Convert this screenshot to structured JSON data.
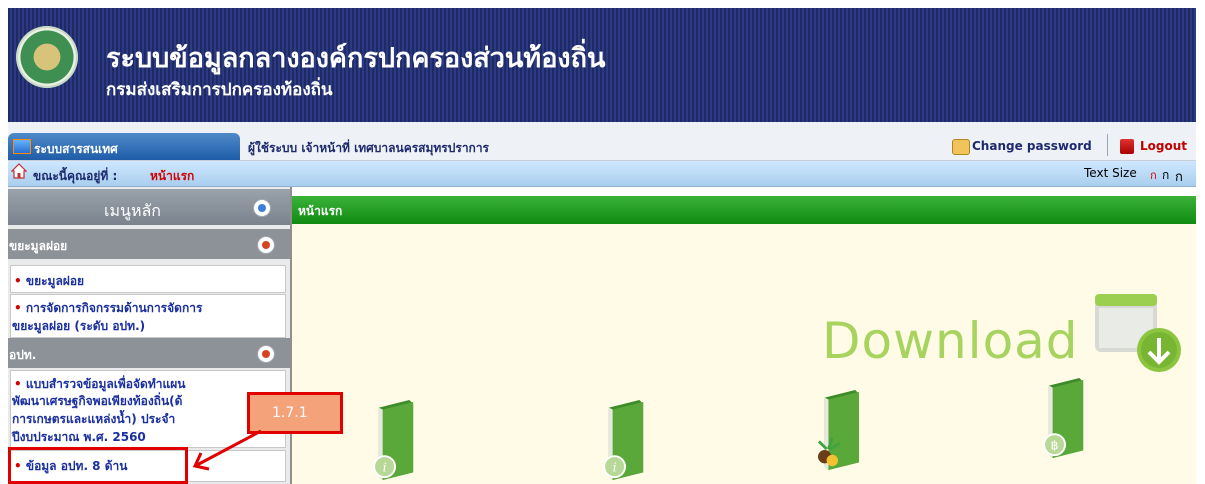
{
  "header": {
    "title": "ระบบข้อมูลกลางองค์กรปกครองส่วนท้องถิ่น",
    "subtitle": "กรมส่งเสริมการปกครองท้องถิ่น"
  },
  "topbar": {
    "system_tab": "ระบบสารสนเทศ",
    "user_info": "ผู้ใช้ระบบ เจ้าหน้าที่ เทศบาลนครสมุทรปราการ",
    "change_password": "Change password",
    "logout": "Logout"
  },
  "location": {
    "label": "ขณะนี้คุณอยู่ที่ :",
    "value": "หน้าแรก",
    "text_size_label": "Text Size",
    "text_size_options": [
      "ก",
      "ก",
      "ก"
    ]
  },
  "sidebar": {
    "title": "เมนูหลัก",
    "sections": [
      {
        "title": "ขยะมูลฝอย",
        "items": [
          {
            "lines": [
              "ขยะมูลฝอย"
            ]
          },
          {
            "lines": [
              "การจัดการกิจกรรมด้านการจัดการ",
              "ขยะมูลฝอย (ระดับ อปท.)"
            ]
          }
        ]
      },
      {
        "title": "อปท.",
        "items": [
          {
            "lines": [
              "แบบสำรวจข้อมูลเพื่อจัดทำแผน",
              "พัฒนาเศรษฐกิจพอเพียงท้องถิ่น(ด้",
              "การเกษตรและแหล่งน้ำ) ประจำ",
              "ปีงบประมาณ พ.ศ. 2560"
            ]
          },
          {
            "lines": [
              "ข้อมูล อปท. 8 ด้าน"
            ]
          }
        ]
      }
    ]
  },
  "main": {
    "title": "หน้าแรก",
    "download_text": "Download"
  },
  "annotation": {
    "label": "1.7.1"
  },
  "colors": {
    "banner": "#1f2a63",
    "main_header": "#118a11",
    "annotation": "#e00000",
    "download": "#a7d35f"
  }
}
